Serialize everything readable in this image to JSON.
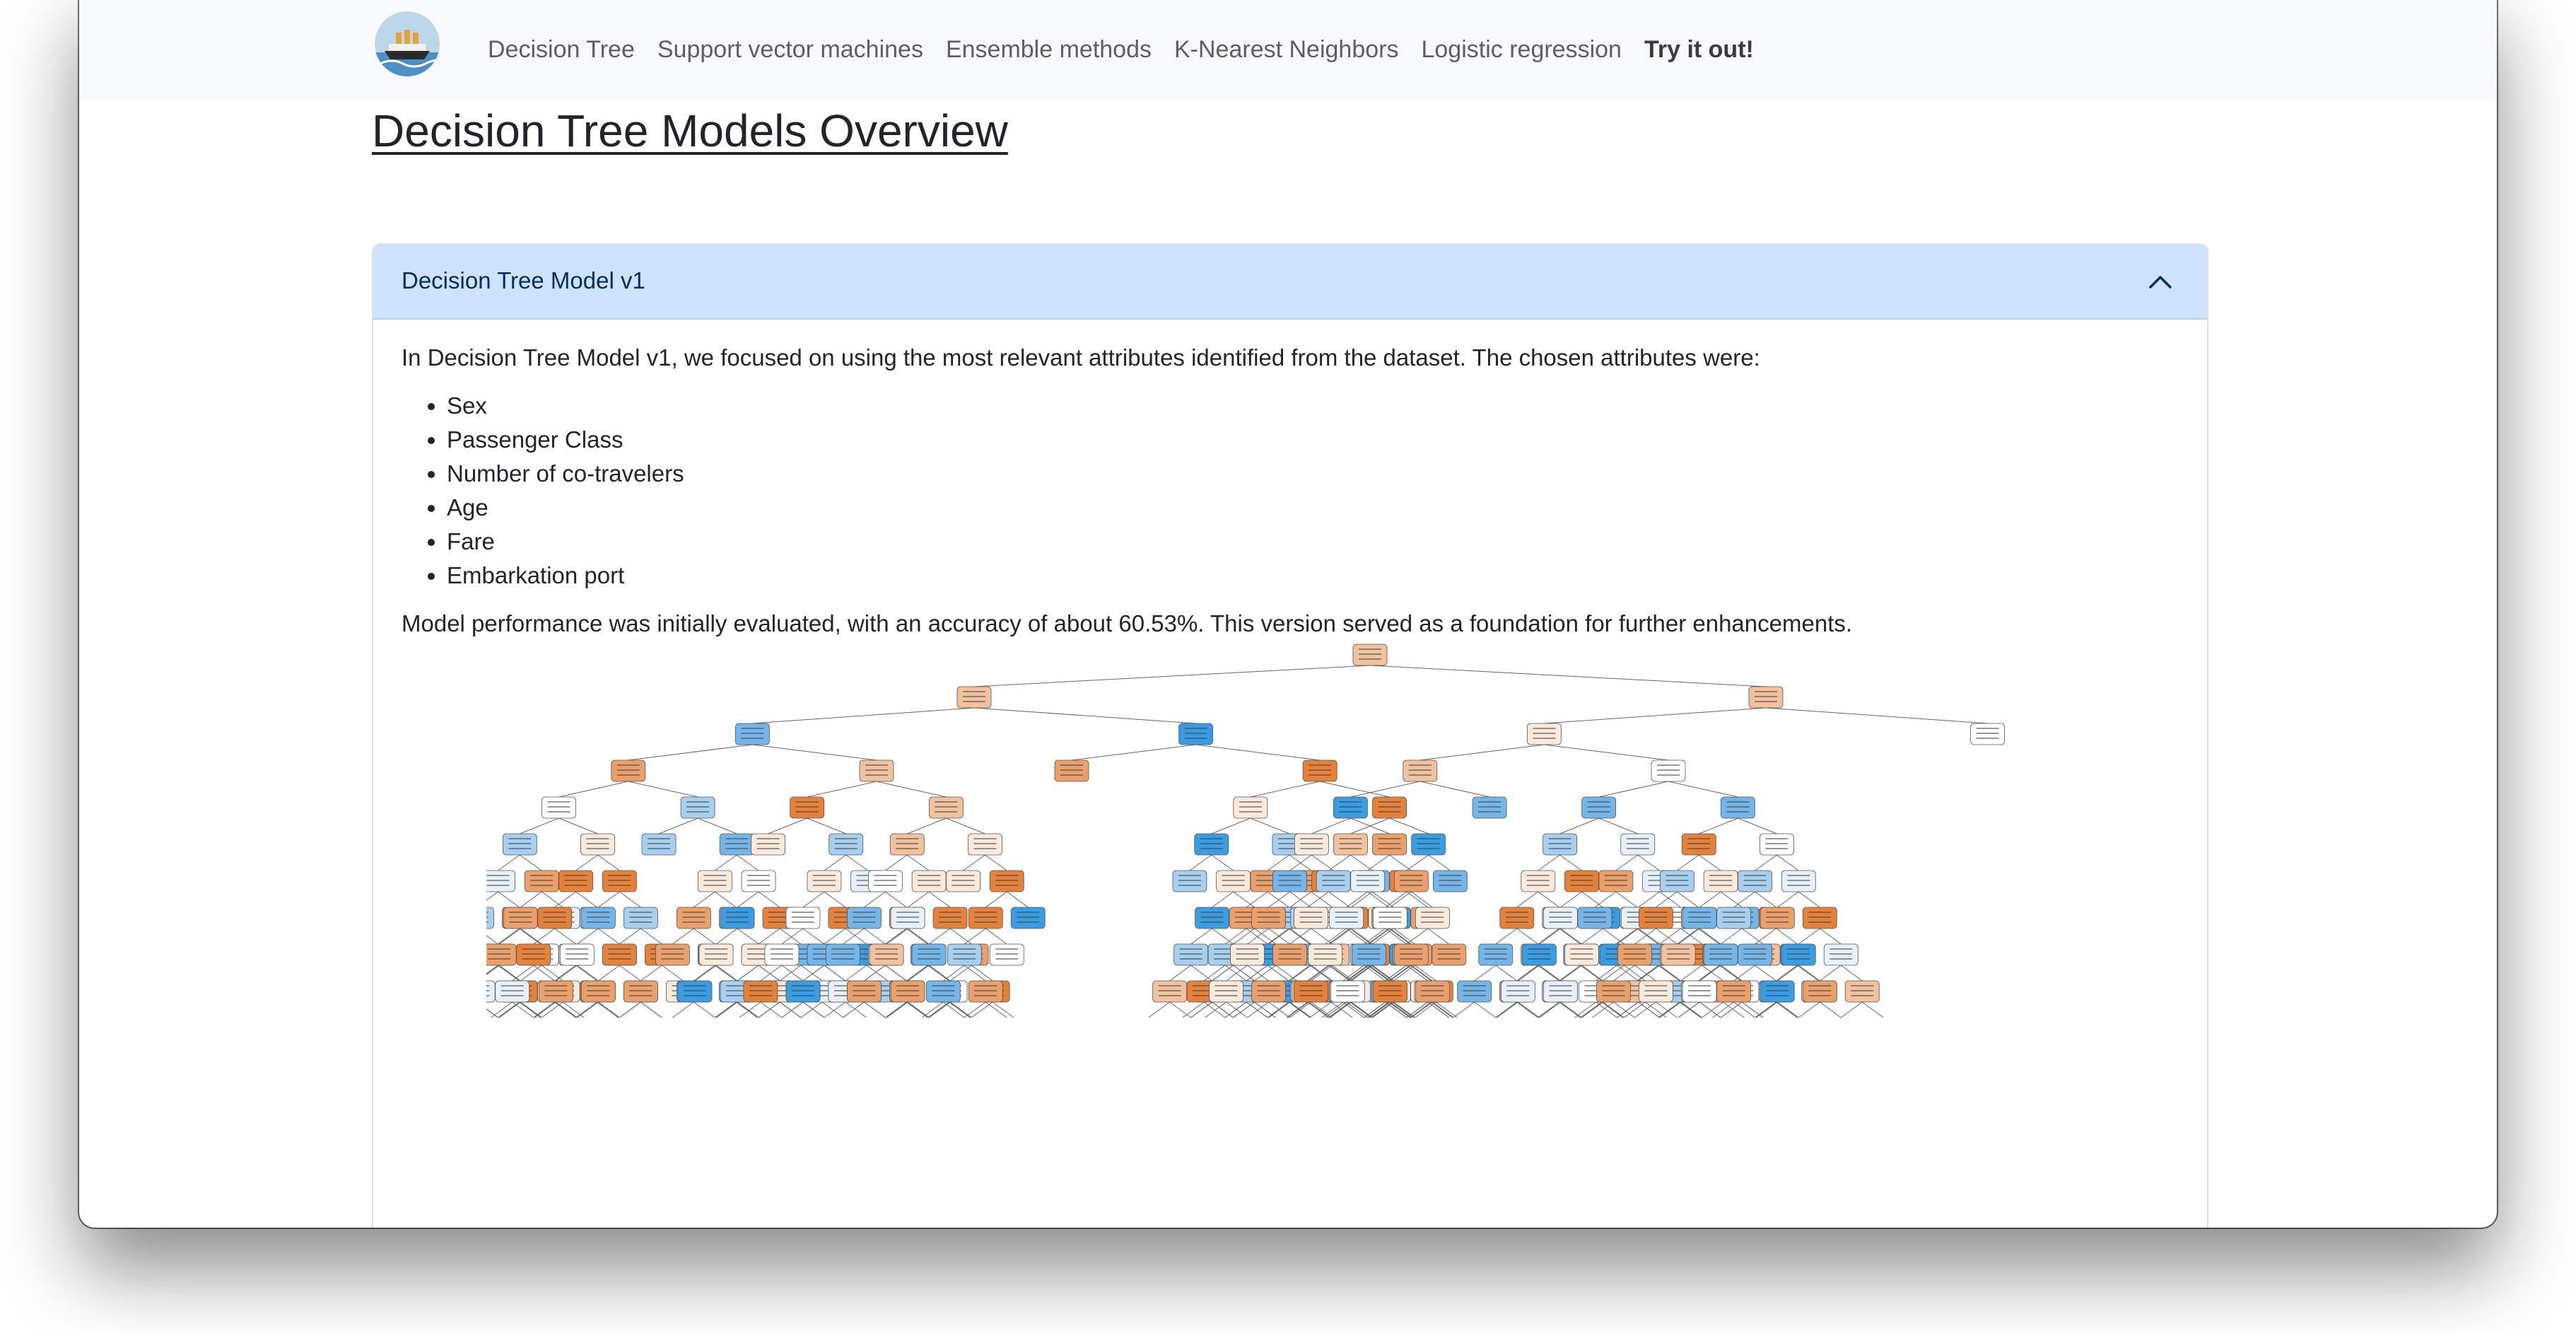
{
  "nav": {
    "logo_icon": "titanic-ship-logo",
    "links": [
      "Decision Tree",
      "Support vector machines",
      "Ensemble methods",
      "K-Nearest Neighbors",
      "Logistic regression",
      "Try it out!"
    ]
  },
  "page": {
    "title": "Decision Tree Models Overview"
  },
  "accordion": {
    "header": "Decision Tree Model v1",
    "expanded": true,
    "intro": "In Decision Tree Model v1, we focused on using the most relevant attributes identified from the dataset. The chosen attributes were:",
    "attributes": [
      "Sex",
      "Passenger Class",
      "Number of co-travelers",
      "Age",
      "Fare",
      "Embarkation port"
    ],
    "performance": "Model performance was initially evaluated, with an accuracy of about 60.53%. This version served as a foundation for further enhancements.",
    "figure_icon": "decision-tree-diagram"
  },
  "colors": {
    "navbar_bg": "#f8f9fa",
    "accordion_header_bg": "#cfe2ff",
    "node_orange": "#e58139",
    "node_blue": "#399de5"
  }
}
